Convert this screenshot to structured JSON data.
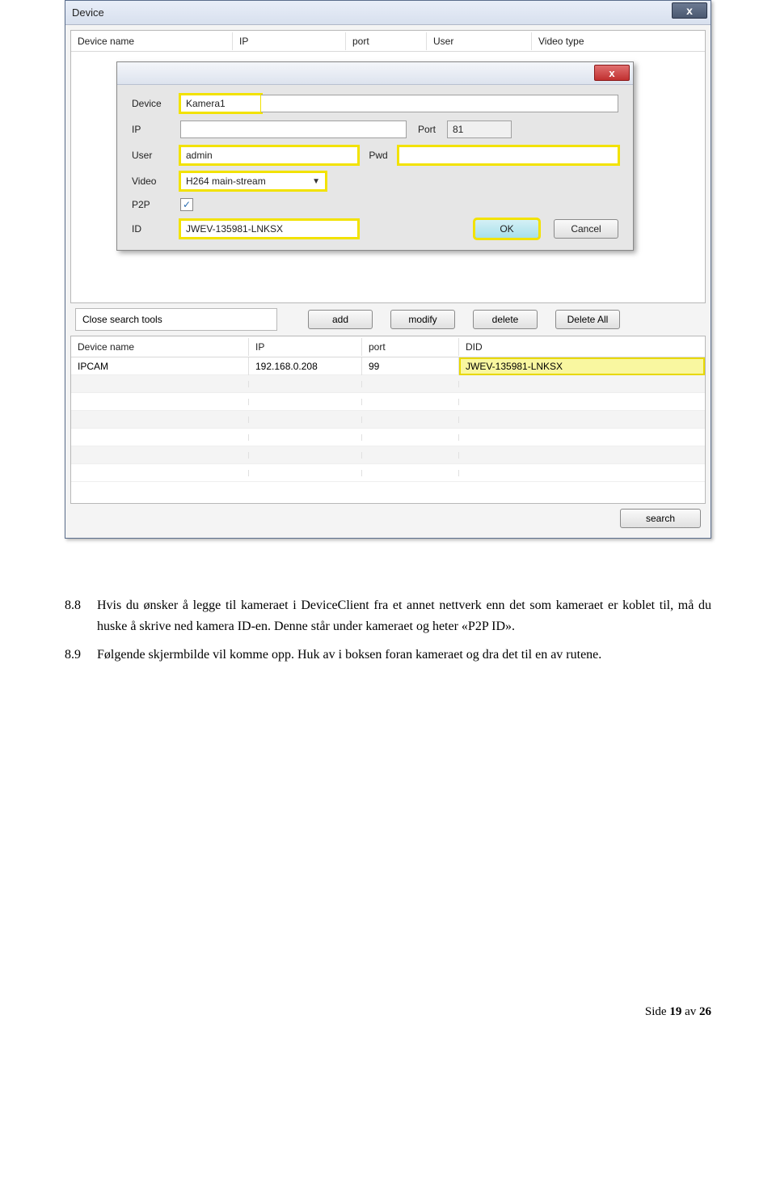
{
  "window": {
    "title": "Device",
    "close_glyph": "x"
  },
  "top_table": {
    "headers": [
      "Device name",
      "IP",
      "port",
      "User",
      "Video type"
    ]
  },
  "modal": {
    "close_glyph": "x",
    "labels": {
      "device": "Device",
      "ip": "IP",
      "port": "Port",
      "user": "User",
      "pwd": "Pwd",
      "video": "Video",
      "p2p": "P2P",
      "id": "ID"
    },
    "values": {
      "device": "Kamera1",
      "ip": "",
      "port": "81",
      "user": "admin",
      "pwd": "",
      "video": "H264 main-stream",
      "p2p_checked": "✓",
      "id": "JWEV-135981-LNKSX"
    },
    "buttons": {
      "ok": "OK",
      "cancel": "Cancel"
    }
  },
  "midbar": {
    "close_search": "Close search tools",
    "add": "add",
    "modify": "modify",
    "delete": "delete",
    "delete_all": "Delete All"
  },
  "lower_table": {
    "headers": [
      "Device name",
      "IP",
      "port",
      "DID"
    ],
    "row": {
      "name": "IPCAM",
      "ip": "192.168.0.208",
      "port": "99",
      "did": "JWEV-135981-LNKSX"
    }
  },
  "search_btn": "search",
  "doc": {
    "p1_num": "8.8",
    "p1": "Hvis du ønsker å legge til kameraet i DeviceClient fra et annet nettverk enn det som kameraet er koblet til, må du huske å skrive ned kamera ID-en. Denne står under kameraet og heter «P2P ID».",
    "p2_num": "8.9",
    "p2": "Følgende skjermbilde vil komme opp. Huk av i boksen foran kameraet og dra det til en av rutene.",
    "footer_prefix": "Side ",
    "footer_page": "19",
    "footer_mid": " av ",
    "footer_total": "26"
  }
}
